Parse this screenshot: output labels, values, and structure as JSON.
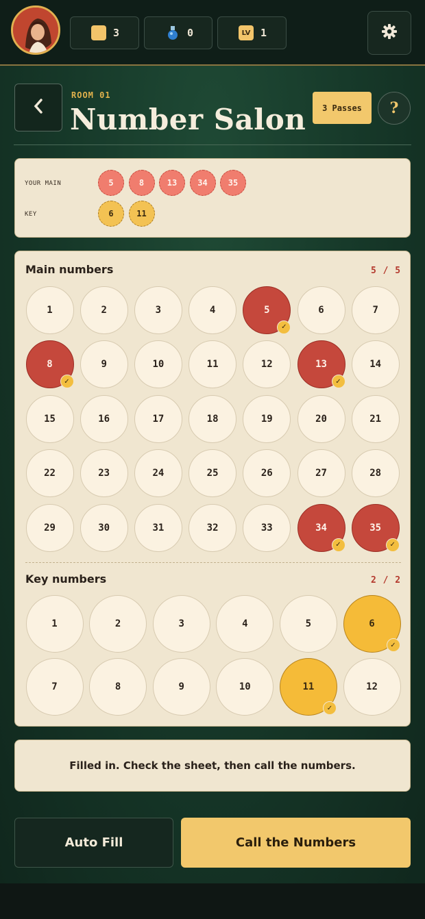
{
  "topbar": {
    "coins": "3",
    "potions": "0",
    "level_badge": "LV",
    "level": "1"
  },
  "header": {
    "room": "ROOM 01",
    "title": "Number Salon",
    "passes": "3 Passes",
    "help": "?"
  },
  "summary": {
    "main_label": "YOUR MAIN",
    "key_label": "KEY",
    "main": [
      "5",
      "8",
      "13",
      "34",
      "35"
    ],
    "key": [
      "6",
      "11"
    ]
  },
  "board": {
    "main_title": "Main numbers",
    "main_counter": "5 / 5",
    "main_numbers": [
      "1",
      "2",
      "3",
      "4",
      "5",
      "6",
      "7",
      "8",
      "9",
      "10",
      "11",
      "12",
      "13",
      "14",
      "15",
      "16",
      "17",
      "18",
      "19",
      "20",
      "21",
      "22",
      "23",
      "24",
      "25",
      "26",
      "27",
      "28",
      "29",
      "30",
      "31",
      "32",
      "33",
      "34",
      "35"
    ],
    "main_selected": [
      "5",
      "8",
      "13",
      "34",
      "35"
    ],
    "key_title": "Key numbers",
    "key_counter": "2 / 2",
    "key_numbers": [
      "1",
      "2",
      "3",
      "4",
      "5",
      "6",
      "7",
      "8",
      "9",
      "10",
      "11",
      "12"
    ],
    "key_selected": [
      "6",
      "11"
    ],
    "check_mark": "✓"
  },
  "status": "Filled in. Check the sheet, then call the numbers.",
  "buttons": {
    "auto_fill": "Auto Fill",
    "call": "Call the Numbers"
  },
  "colors": {
    "felt": "#173a2a",
    "accent_gold": "#f2c86c",
    "main_selected": "#c5483c",
    "key_selected": "#f5bb38"
  }
}
